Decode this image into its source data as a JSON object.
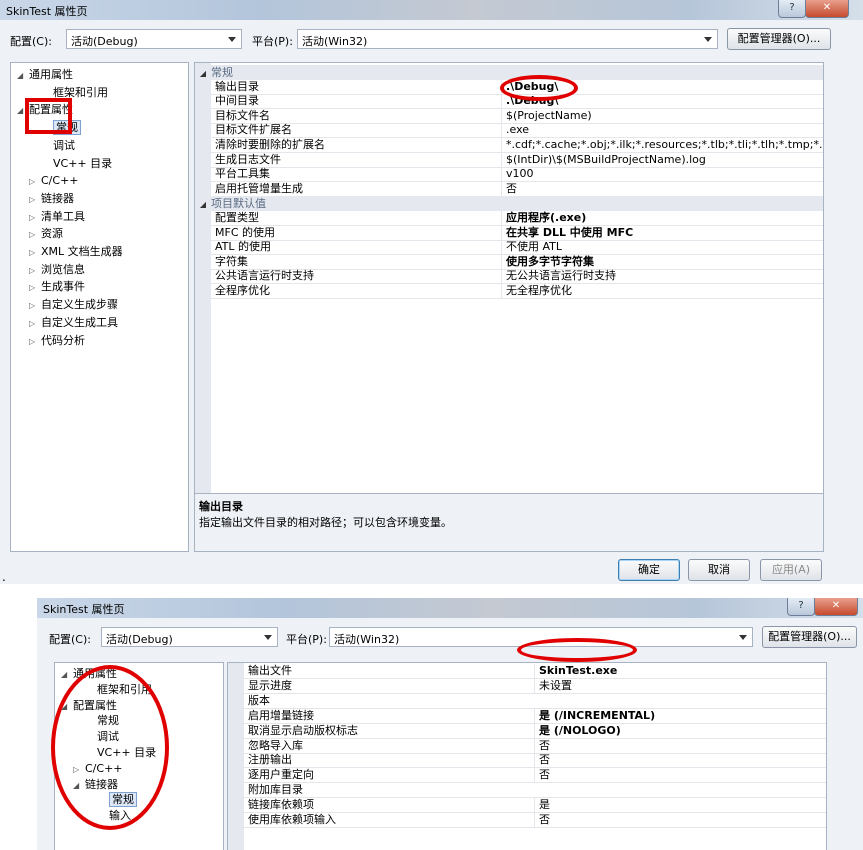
{
  "dialog1": {
    "title": "SkinTest 属性页",
    "help_glyph": "?",
    "close_glyph": "✕",
    "config_label": "配置(C):",
    "config_value": "活动(Debug)",
    "platform_label": "平台(P):",
    "platform_value": "活动(Win32)",
    "config_manager_button": "配置管理器(O)...",
    "tree": [
      {
        "label": "通用属性",
        "expander": "◢",
        "indent": 0
      },
      {
        "label": "框架和引用",
        "expander": "",
        "indent": 2
      },
      {
        "label": "配置属性",
        "expander": "◢",
        "indent": 0
      },
      {
        "label": "常规",
        "expander": "",
        "indent": 2,
        "selected": true
      },
      {
        "label": "调试",
        "expander": "",
        "indent": 2
      },
      {
        "label": "VC++ 目录",
        "expander": "",
        "indent": 2
      },
      {
        "label": "C/C++",
        "expander": "▷",
        "indent": 1
      },
      {
        "label": "链接器",
        "expander": "▷",
        "indent": 1
      },
      {
        "label": "清单工具",
        "expander": "▷",
        "indent": 1
      },
      {
        "label": "资源",
        "expander": "▷",
        "indent": 1
      },
      {
        "label": "XML 文档生成器",
        "expander": "▷",
        "indent": 1
      },
      {
        "label": "浏览信息",
        "expander": "▷",
        "indent": 1
      },
      {
        "label": "生成事件",
        "expander": "▷",
        "indent": 1
      },
      {
        "label": "自定义生成步骤",
        "expander": "▷",
        "indent": 1
      },
      {
        "label": "自定义生成工具",
        "expander": "▷",
        "indent": 1
      },
      {
        "label": "代码分析",
        "expander": "▷",
        "indent": 1
      }
    ],
    "grid": [
      {
        "type": "cat",
        "label": "常规",
        "expander": "◢"
      },
      {
        "type": "row",
        "key": "输出目录",
        "value": ".\\Debug\\",
        "bold": true
      },
      {
        "type": "row",
        "key": "中间目录",
        "value": ".\\Debug\\",
        "bold": true
      },
      {
        "type": "row",
        "key": "目标文件名",
        "value": "$(ProjectName)"
      },
      {
        "type": "row",
        "key": "目标文件扩展名",
        "value": ".exe"
      },
      {
        "type": "row",
        "key": "清除时要删除的扩展名",
        "value": "*.cdf;*.cache;*.obj;*.ilk;*.resources;*.tlb;*.tli;*.tlh;*.tmp;*.rsp;*.pgc"
      },
      {
        "type": "row",
        "key": "生成日志文件",
        "value": "$(IntDir)\\$(MSBuildProjectName).log"
      },
      {
        "type": "row",
        "key": "平台工具集",
        "value": "v100"
      },
      {
        "type": "row",
        "key": "启用托管增量生成",
        "value": "否"
      },
      {
        "type": "cat",
        "label": "项目默认值",
        "expander": "◢"
      },
      {
        "type": "row",
        "key": "配置类型",
        "value": "应用程序(.exe)",
        "bold": true
      },
      {
        "type": "row",
        "key": "MFC 的使用",
        "value": "在共享 DLL 中使用 MFC",
        "bold": true
      },
      {
        "type": "row",
        "key": "ATL 的使用",
        "value": "不使用 ATL"
      },
      {
        "type": "row",
        "key": "字符集",
        "value": "使用多字节字符集",
        "bold": true
      },
      {
        "type": "row",
        "key": "公共语言运行时支持",
        "value": "无公共语言运行时支持"
      },
      {
        "type": "row",
        "key": "全程序优化",
        "value": "无全程序优化"
      }
    ],
    "desc_title": "输出目录",
    "desc_text": "指定输出文件目录的相对路径；可以包含环境变量。",
    "ok_button": "确定",
    "cancel_button": "取消",
    "apply_button": "应用(A)"
  },
  "stray_mark": ".",
  "dialog2": {
    "title": "SkinTest 属性页",
    "help_glyph": "?",
    "close_glyph": "✕",
    "config_label": "配置(C):",
    "config_value": "活动(Debug)",
    "platform_label": "平台(P):",
    "platform_value": "活动(Win32)",
    "config_manager_button": "配置管理器(O)...",
    "tree": [
      {
        "label": "通用属性",
        "expander": "◢",
        "indent": 0
      },
      {
        "label": "框架和引用",
        "expander": "",
        "indent": 2
      },
      {
        "label": "配置属性",
        "expander": "◢",
        "indent": 0
      },
      {
        "label": "常规",
        "expander": "",
        "indent": 2
      },
      {
        "label": "调试",
        "expander": "",
        "indent": 2
      },
      {
        "label": "VC++ 目录",
        "expander": "",
        "indent": 2
      },
      {
        "label": "C/C++",
        "expander": "▷",
        "indent": 1
      },
      {
        "label": "链接器",
        "expander": "◢",
        "indent": 1
      },
      {
        "label": "常规",
        "expander": "",
        "indent": 3,
        "selected": true
      },
      {
        "label": "输入",
        "expander": "",
        "indent": 3
      }
    ],
    "grid": [
      {
        "type": "row",
        "key": "输出文件",
        "value": "SkinTest.exe",
        "bold": true
      },
      {
        "type": "row",
        "key": "显示进度",
        "value": "未设置"
      },
      {
        "type": "row",
        "key": "版本",
        "value": ""
      },
      {
        "type": "row",
        "key": "启用增量链接",
        "value": "是 (/INCREMENTAL)",
        "bold": true
      },
      {
        "type": "row",
        "key": "取消显示启动版权标志",
        "value": "是 (/NOLOGO)",
        "bold": true
      },
      {
        "type": "row",
        "key": "忽略导入库",
        "value": "否"
      },
      {
        "type": "row",
        "key": "注册输出",
        "value": "否"
      },
      {
        "type": "row",
        "key": "逐用户重定向",
        "value": "否"
      },
      {
        "type": "row",
        "key": "附加库目录",
        "value": ""
      },
      {
        "type": "row",
        "key": "链接库依赖项",
        "value": "是"
      },
      {
        "type": "row",
        "key": "使用库依赖项输入",
        "value": "否"
      }
    ]
  }
}
